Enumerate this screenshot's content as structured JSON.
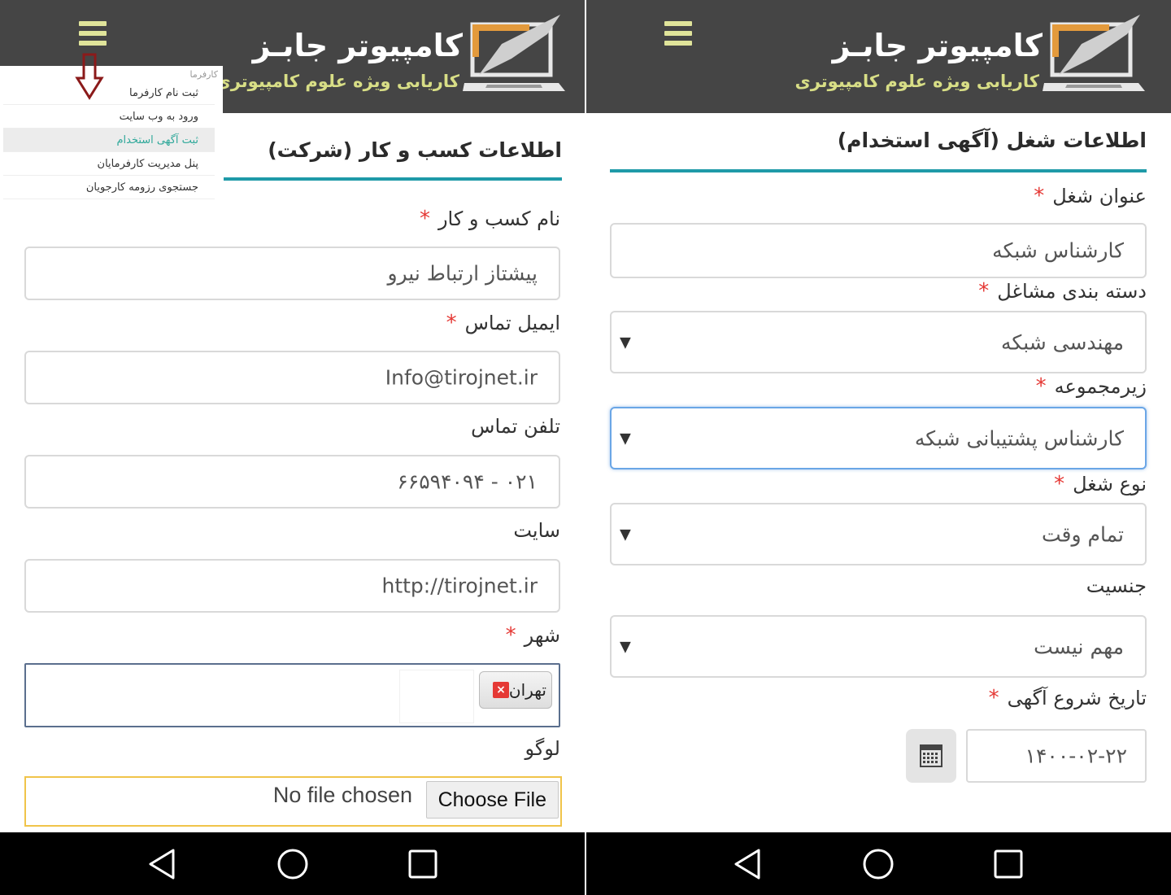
{
  "brand": {
    "title": "کامپیوتر جابـز",
    "subtitle": "کاریابی ویژه علوم کامپیوتری"
  },
  "left": {
    "section_title": "اطلاعات کسب و کار (شرکت)",
    "menu": {
      "category": "کارفرما",
      "items": [
        {
          "label": "ثبت نام کارفرما"
        },
        {
          "label": "ورود به وب سایت"
        },
        {
          "label": "ثبت آگهی استخدام"
        },
        {
          "label": "پنل مدیریت کارفرمایان"
        },
        {
          "label": "جستجوی رزومه کارجویان"
        }
      ]
    },
    "fields": {
      "business_name": {
        "label": "نام کسب و کار",
        "value": "پیشتاز ارتباط نیرو"
      },
      "email": {
        "label": "ایمیل تماس",
        "value": "Info@tirojnet.ir"
      },
      "phone": {
        "label": "تلفن تماس",
        "value": "۰۲۱ - ۶۶۵۹۴۰۹۴"
      },
      "website": {
        "label": "سایت",
        "value": "http://tirojnet.ir"
      },
      "city": {
        "label": "شهر",
        "tag": "تهران",
        "remove": "×"
      },
      "logo": {
        "label": "لوگو",
        "button": "Choose File",
        "status": "No file chosen"
      }
    },
    "required_mark": "*"
  },
  "right": {
    "section_title": "اطلاعات شغل (آگهی استخدام)",
    "fields": {
      "job_title": {
        "label": "عنوان شغل",
        "value": "کارشناس شبکه"
      },
      "category": {
        "label": "دسته بندی مشاغل",
        "value": "مهندسی شبکه"
      },
      "subcategory": {
        "label": "زیرمجموعه",
        "value": "کارشناس پشتیبانی شبکه"
      },
      "job_type": {
        "label": "نوع شغل",
        "value": "تمام وقت"
      },
      "gender": {
        "label": "جنسیت",
        "value": "مهم نیست"
      },
      "start_date": {
        "label": "تاریخ شروع آگهی",
        "value": "۱۴۰۰-۰۲-۲۲"
      }
    },
    "required_mark": "*",
    "dropdown_caret": "▼"
  },
  "icons": {
    "menu": "hamburger-icon",
    "logo": "laptop-logo-icon",
    "arrow": "down-arrow-icon",
    "calendar": "calendar-icon",
    "nav_back": "back-triangle-icon",
    "nav_home": "home-circle-icon",
    "nav_recent": "recent-square-icon"
  },
  "colors": {
    "header_bg": "#454545",
    "subtitle": "#d8de86",
    "accent_line": "#1f9aa8",
    "required": "#e53935",
    "menu_active": "#2fa89a",
    "focus_border": "#6aa6e6",
    "file_border": "#f0c44a",
    "arrow": "#8b1a1a"
  }
}
